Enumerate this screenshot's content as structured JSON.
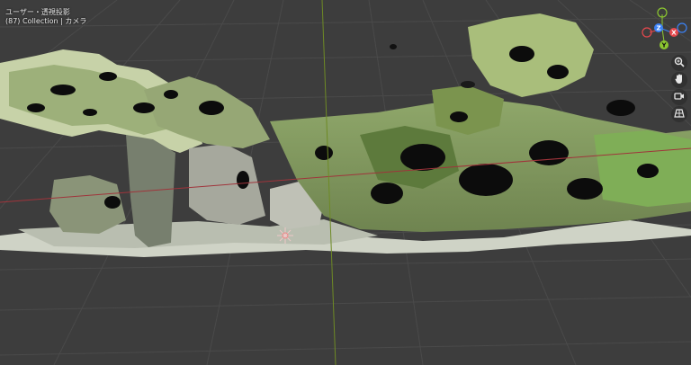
{
  "hud": {
    "view_mode": "ユーザー・透視投影",
    "frame_collection": "(87) Collection | カメラ"
  },
  "gizmo": {
    "axis_x": "X",
    "axis_y": "Y",
    "axis_z": "Z",
    "colors": {
      "x": "#e5484d",
      "y": "#8cc730",
      "z": "#3b82f6"
    }
  },
  "nav_buttons": [
    {
      "icon": "zoom-icon"
    },
    {
      "icon": "hand-pan-icon"
    },
    {
      "icon": "camera-view-icon"
    },
    {
      "icon": "perspective-grid-icon"
    }
  ],
  "scene": {
    "background": "#3d3d3d",
    "grid_line_color": "#484848",
    "x_axis_color": "#a0343b",
    "y_axis_color": "#6e8a25"
  }
}
